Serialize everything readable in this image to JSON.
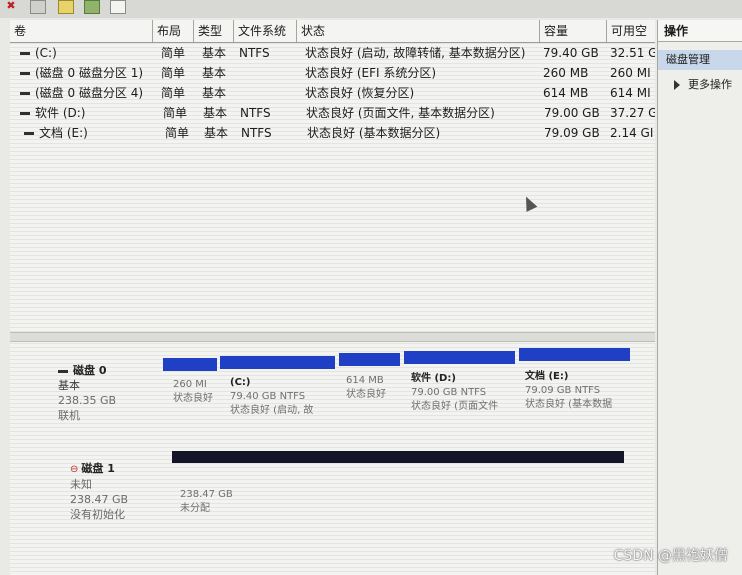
{
  "columns": [
    "卷",
    "布局",
    "类型",
    "文件系统",
    "状态",
    "容量",
    "可用空"
  ],
  "volumes": [
    {
      "name": "(C:)",
      "layout": "简单",
      "type": "基本",
      "fs": "NTFS",
      "status": "状态良好 (启动, 故障转储, 基本数据分区)",
      "capacity": "79.40 GB",
      "free": "32.51 G"
    },
    {
      "name": "(磁盘 0 磁盘分区 1)",
      "layout": "简单",
      "type": "基本",
      "fs": "",
      "status": "状态良好 (EFI 系统分区)",
      "capacity": "260 MB",
      "free": "260 MI"
    },
    {
      "name": "(磁盘 0 磁盘分区 4)",
      "layout": "简单",
      "type": "基本",
      "fs": "",
      "status": "状态良好 (恢复分区)",
      "capacity": "614 MB",
      "free": "614 MI"
    },
    {
      "name": "软件 (D:)",
      "layout": "简单",
      "type": "基本",
      "fs": "NTFS",
      "status": "状态良好 (页面文件, 基本数据分区)",
      "capacity": "79.00 GB",
      "free": "37.27 G"
    },
    {
      "name": "文档 (E:)",
      "layout": "简单",
      "type": "基本",
      "fs": "NTFS",
      "status": "状态良好 (基本数据分区)",
      "capacity": "79.09 GB",
      "free": "2.14 GI"
    }
  ],
  "disk0": {
    "title": "磁盘 0",
    "type": "基本",
    "size": "238.35 GB",
    "status": "联机",
    "partitions": [
      {
        "name": "",
        "size": "260 MI",
        "status": "状态良好"
      },
      {
        "name": "(C:)",
        "size": "79.40 GB NTFS",
        "status": "状态良好 (启动, 故"
      },
      {
        "name": "",
        "size": "614 MB",
        "status": "状态良好"
      },
      {
        "name": "软件 (D:)",
        "size": "79.00 GB NTFS",
        "status": "状态良好 (页面文件"
      },
      {
        "name": "文档 (E:)",
        "size": "79.09 GB NTFS",
        "status": "状态良好 (基本数据"
      }
    ]
  },
  "disk1": {
    "title": "磁盘 1",
    "type": "未知",
    "size": "238.47 GB",
    "status": "没有初始化",
    "unalloc_size": "238.47 GB",
    "unalloc_label": "未分配"
  },
  "actions": {
    "header": "操作",
    "selected": "磁盘管理",
    "more": "更多操作"
  },
  "watermark": "CSDN @黑袍妖僧",
  "colors": {
    "partition": "#1f3fc4",
    "unallocated": "#15152a"
  }
}
